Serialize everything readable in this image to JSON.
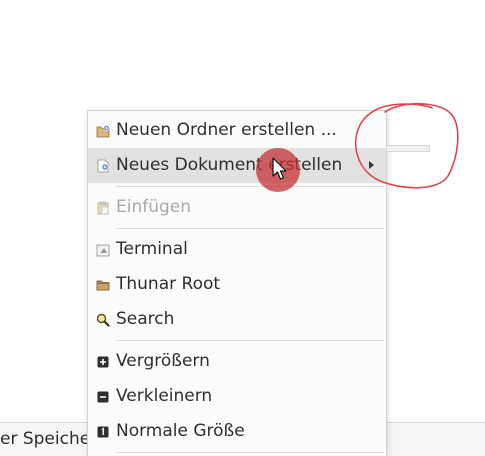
{
  "statusbar": {
    "text": "er Speicher"
  },
  "menu": {
    "items": [
      {
        "label": "Neuen Ordner erstellen ...",
        "icon": "new-folder-icon"
      },
      {
        "label": "Neues Dokument erstellen",
        "icon": "new-document-icon",
        "submenu": true
      },
      {
        "label": "Einfügen",
        "icon": "paste-icon",
        "disabled": true
      },
      {
        "label": "Terminal",
        "icon": "terminal-icon"
      },
      {
        "label": "Thunar Root",
        "icon": "folder-icon"
      },
      {
        "label": "Search",
        "icon": "search-icon"
      },
      {
        "label": "Vergrößern",
        "icon": "zoom-in-icon"
      },
      {
        "label": "Verkleinern",
        "icon": "zoom-out-icon"
      },
      {
        "label": "Normale Größe",
        "icon": "zoom-normal-icon"
      }
    ]
  },
  "colors": {
    "highlight": "#e1e1df",
    "annotation": "#e0444c",
    "click_marker": "#c43238"
  }
}
